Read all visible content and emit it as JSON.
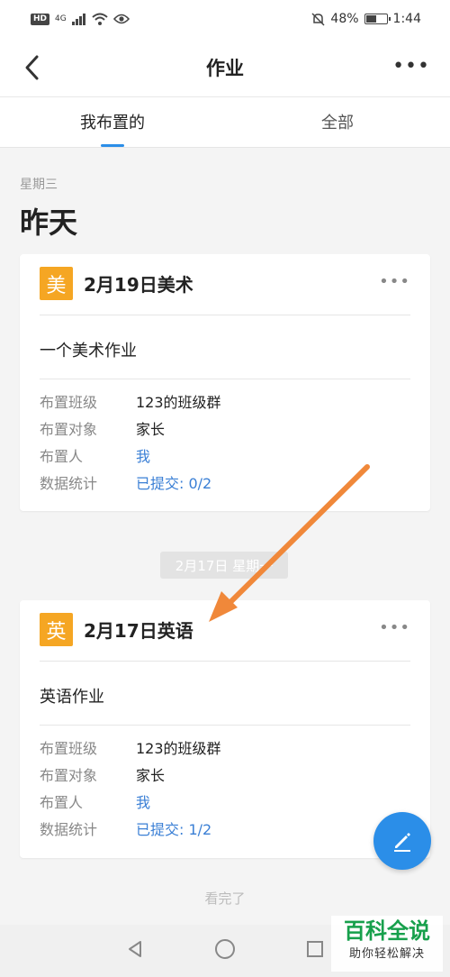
{
  "status_bar": {
    "battery": "48%",
    "time": "1:44",
    "hd_label": "HD",
    "signal_label": "4G"
  },
  "nav": {
    "title": "作业",
    "back_icon": "chevron-left-icon",
    "more_icon": "more-dots-icon"
  },
  "tabs": [
    {
      "label": "我布置的",
      "active": true
    },
    {
      "label": "全部",
      "active": false
    }
  ],
  "section": {
    "weekday": "星期三",
    "day": "昨天"
  },
  "cards": [
    {
      "badge": "美",
      "title": "2月19日美术",
      "desc": "一个美术作业",
      "rows": [
        {
          "k": "布置班级",
          "v": "123的班级群"
        },
        {
          "k": "布置对象",
          "v": "家长"
        },
        {
          "k": "布置人",
          "v": "我"
        },
        {
          "k": "数据统计",
          "v": "已提交: 0/2"
        }
      ]
    },
    {
      "badge": "英",
      "title": "2月17日英语",
      "desc": "英语作业",
      "rows": [
        {
          "k": "布置班级",
          "v": "123的班级群"
        },
        {
          "k": "布置对象",
          "v": "家长"
        },
        {
          "k": "布置人",
          "v": "我"
        },
        {
          "k": "数据统计",
          "v": "已提交: 1/2"
        }
      ]
    }
  ],
  "date_pill": "2月17日 星期一",
  "footer": "看完了",
  "watermark": {
    "line1": "百科全说",
    "line2": "助你轻松解决"
  },
  "colors": {
    "accent": "#2b8ee8",
    "badge": "#f5a623",
    "arrow": "#f0883a"
  }
}
